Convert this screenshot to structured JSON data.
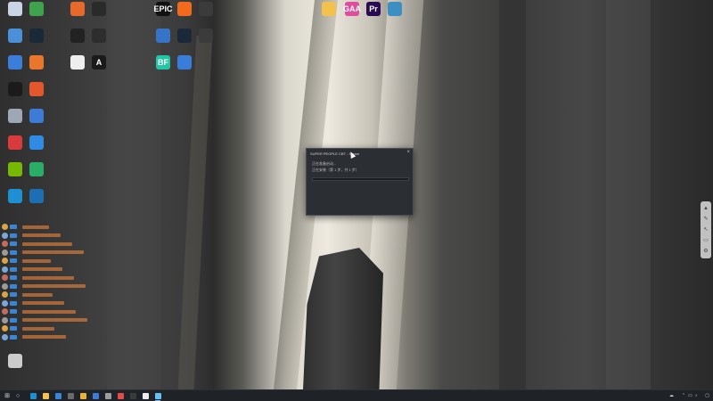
{
  "desktop_icons": [
    {
      "label": "",
      "icon": "app-icon",
      "color": "#c9d4e6"
    },
    {
      "label": "",
      "icon": "app-icon",
      "color": "#3fa34d"
    },
    {
      "label": "",
      "icon": "app-icon",
      "color": "#e86a2b"
    },
    {
      "label": "",
      "icon": "app-icon",
      "color": "#2a2a2a"
    },
    {
      "label": "EPIC",
      "icon": "epic-games-icon",
      "color": "#111111"
    },
    {
      "label": "",
      "icon": "origin-icon",
      "color": "#f26b1d"
    },
    {
      "label": "",
      "icon": "obs-icon",
      "color": "#3b3b3b"
    },
    {
      "label": "",
      "icon": "folder-icon",
      "color": "#f2c14e"
    },
    {
      "label": "GAA",
      "icon": "app-icon",
      "color": "#e14c9c"
    },
    {
      "label": "Pr",
      "icon": "premiere-icon",
      "color": "#2a0a52"
    },
    {
      "label": "",
      "icon": "app-icon",
      "color": "#3c8fc2"
    },
    {
      "label": "",
      "icon": "app-icon",
      "color": "#4a90d9"
    },
    {
      "label": "",
      "icon": "steam-icon",
      "color": "#1b2838"
    },
    {
      "label": "",
      "icon": "wolf-icon",
      "color": "#222222"
    },
    {
      "label": "",
      "icon": "osu-icon",
      "color": "#2d2d2d"
    },
    {
      "label": "",
      "icon": "app-icon",
      "color": "#3574c6"
    },
    {
      "label": "",
      "icon": "steam-icon",
      "color": "#1b2838"
    },
    {
      "label": "",
      "icon": "game-icon",
      "color": "#3b3b3b"
    },
    {
      "label": "",
      "icon": "app-icon",
      "color": "#3b7dd8"
    },
    {
      "label": "",
      "icon": "app-icon",
      "color": "#e9762b"
    },
    {
      "label": "",
      "icon": "app-icon",
      "color": "#eeeeee"
    },
    {
      "label": "A",
      "icon": "app-icon",
      "color": "#1a1a1a"
    },
    {
      "label": "BF",
      "icon": "app-icon",
      "color": "#22c5a6"
    },
    {
      "label": "",
      "icon": "app-icon",
      "color": "#3a7dd8"
    },
    {
      "label": "",
      "icon": "qq-icon",
      "color": "#1b1b1b"
    },
    {
      "label": "",
      "icon": "app-icon",
      "color": "#e2582a"
    },
    {
      "label": "",
      "icon": "app-icon",
      "color": "#9ea7b3"
    },
    {
      "label": "",
      "icon": "app-icon",
      "color": "#3c7cd6"
    },
    {
      "label": "",
      "icon": "netease-music-icon",
      "color": "#d83b3b"
    },
    {
      "label": "",
      "icon": "app-icon",
      "color": "#2f8be6"
    },
    {
      "label": "",
      "icon": "nvidia-icon",
      "color": "#76b900"
    },
    {
      "label": "",
      "icon": "wechat-icon",
      "color": "#2aae67"
    },
    {
      "label": "",
      "icon": "edge-icon",
      "color": "#1d8fd3"
    },
    {
      "label": "",
      "icon": "app-icon",
      "color": "#1d6fb4"
    },
    {
      "label": "",
      "icon": "app-icon",
      "color": "#cccccc"
    }
  ],
  "dialog": {
    "title": "SUPER PEOPLE CBT - Steam",
    "line1": "正在准备启动...",
    "line2": "正在安装（第 1 步，共 1 步）",
    "progress_fraction": 0.0,
    "close_glyph": "×"
  },
  "chat": {
    "rows": [
      {
        "badge": "",
        "name": "",
        "msg": ""
      },
      {
        "badge": "",
        "name": "",
        "msg": ""
      },
      {
        "badge": "",
        "name": "",
        "msg": ""
      },
      {
        "badge": "",
        "name": "",
        "msg": ""
      },
      {
        "badge": "",
        "name": "",
        "msg": ""
      },
      {
        "badge": "",
        "name": "",
        "msg": ""
      },
      {
        "badge": "",
        "name": "",
        "msg": ""
      },
      {
        "badge": "",
        "name": "",
        "msg": ""
      },
      {
        "badge": "",
        "name": "",
        "msg": ""
      },
      {
        "badge": "",
        "name": "",
        "msg": ""
      },
      {
        "badge": "",
        "name": "",
        "msg": ""
      },
      {
        "badge": "",
        "name": "",
        "msg": ""
      },
      {
        "badge": "",
        "name": "",
        "msg": ""
      },
      {
        "badge": "",
        "name": "",
        "msg": ""
      }
    ]
  },
  "side_toolbar": {
    "items": [
      {
        "icon": "up-icon",
        "glyph": "▲"
      },
      {
        "icon": "pen-icon",
        "glyph": "✎"
      },
      {
        "icon": "pointer-icon",
        "glyph": "↖"
      },
      {
        "icon": "screen-icon",
        "glyph": "▭"
      },
      {
        "icon": "settings-icon",
        "glyph": "⚙"
      }
    ]
  },
  "taskbar": {
    "start_glyph": "⊞",
    "search_glyph": "○",
    "apps": [
      {
        "icon": "edge-icon",
        "color": "#1d8fd3",
        "active": false
      },
      {
        "icon": "file-explorer-icon",
        "color": "#f2c14e",
        "active": false
      },
      {
        "icon": "store-icon",
        "color": "#3a86d6",
        "active": false
      },
      {
        "icon": "app-icon",
        "color": "#6a6a6a",
        "active": false
      },
      {
        "icon": "app-icon",
        "color": "#e8b23a",
        "active": false
      },
      {
        "icon": "app-icon",
        "color": "#3c7cd6",
        "active": false
      },
      {
        "icon": "app-icon",
        "color": "#9d9d9d",
        "active": false
      },
      {
        "icon": "app-icon",
        "color": "#e34b4b",
        "active": false
      },
      {
        "icon": "app-icon",
        "color": "#3a3a3a",
        "active": false
      },
      {
        "icon": "app-icon",
        "color": "#ededed",
        "active": false
      },
      {
        "icon": "steam-icon",
        "color": "#66c0f4",
        "active": true
      }
    ],
    "tray": {
      "weather_glyph": "☁",
      "temperature": "",
      "air": "",
      "ime": "",
      "time": "",
      "date": ""
    }
  }
}
